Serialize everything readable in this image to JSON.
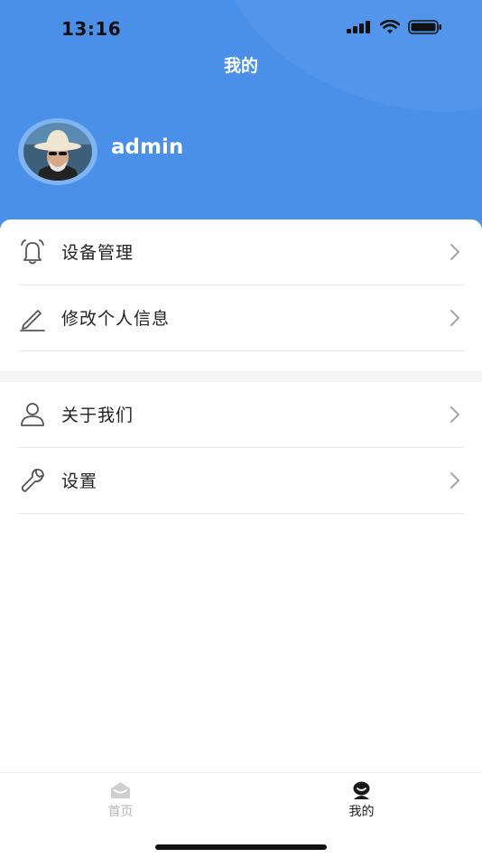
{
  "status_bar": {
    "time": "13:16",
    "icons": [
      "signal-icon",
      "wifi-icon",
      "battery-icon"
    ]
  },
  "header": {
    "title": "我的",
    "username": "admin",
    "background_color": "#4a8fe8"
  },
  "menu": {
    "group1": [
      {
        "label": "设备管理",
        "icon": "bell-icon"
      },
      {
        "label": "修改个人信息",
        "icon": "pencil-icon"
      }
    ],
    "group2": [
      {
        "label": "关于我们",
        "icon": "user-icon"
      },
      {
        "label": "设置",
        "icon": "wrench-icon"
      }
    ]
  },
  "tabbar": {
    "tabs": [
      {
        "label": "首页",
        "icon": "home-icon",
        "active": false
      },
      {
        "label": "我的",
        "icon": "profile-icon",
        "active": true
      }
    ],
    "active_color": "#222222",
    "inactive_color": "#b5b5b5"
  }
}
